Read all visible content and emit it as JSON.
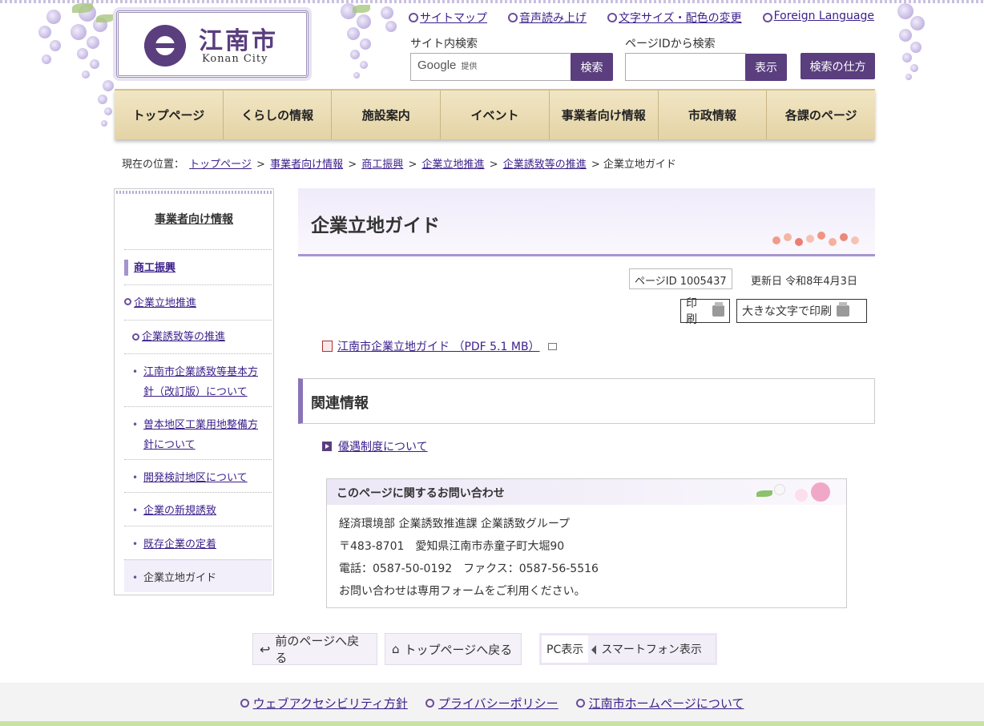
{
  "logo": {
    "jp": "江南市",
    "en": "Konan City"
  },
  "toplinks": [
    "サイトマップ",
    "音声読み上げ",
    "文字サイズ・配色の変更",
    "Foreign Language"
  ],
  "search": {
    "site_label": "サイト内検索",
    "google_text": "Google",
    "google_sub": "提供",
    "site_button": "検索",
    "pageid_label": "ページIDから検索",
    "pageid_button": "表示",
    "howto_button": "検索の仕方"
  },
  "gnav": [
    "トップページ",
    "くらしの情報",
    "施設案内",
    "イベント",
    "事業者向け情報",
    "市政情報",
    "各課のページ"
  ],
  "breadcrumb": {
    "prefix": "現在の位置：",
    "items": [
      "トップページ",
      "事業者向け情報",
      "商工振興",
      "企業立地推進",
      "企業誘致等の推進"
    ],
    "current": "企業立地ガイド",
    "sep": ">"
  },
  "sidebar": {
    "title": "事業者向け情報",
    "items": [
      "商工振興",
      "企業立地推進",
      "企業誘致等の推進",
      "江南市企業誘致等基本方針（改訂版）について",
      "曽本地区工業用地整備方針について",
      "開発検討地区について",
      "企業の新規誘致",
      "既存企業の定着",
      "企業立地ガイド"
    ]
  },
  "page": {
    "title": "企業立地ガイド",
    "pageid": "ページID 1005437",
    "updated": "更新日 令和8年4月3日",
    "print": "印刷",
    "print_large": "大きな文字で印刷",
    "pdf_link": "江南市企業立地ガイド （PDF 5.1 MB）",
    "related_heading": "関連情報",
    "related_link": "優遇制度について"
  },
  "contact": {
    "heading": "このページに関するお問い合わせ",
    "lines": [
      "経済環境部 企業誘致推進課 企業誘致グループ",
      "〒483-8701　愛知県江南市赤童子町大堀90",
      "電話：0587-50-0192　ファクス：0587-56-5516",
      "お問い合わせは専用フォームをご利用ください。"
    ]
  },
  "bottom_nav": {
    "back": "前のページへ戻る",
    "top": "トップページへ戻る",
    "pc": "PC表示",
    "smartphone": "スマートフォン表示"
  },
  "footer": [
    "ウェブアクセシビリティ方針",
    "プライバシーポリシー",
    "江南市ホームページについて"
  ],
  "colors": {
    "accent": "#5a3e7e",
    "link": "#3b1f8a",
    "nav_bg": "#e9dbb3",
    "lavender": "#a796cf"
  }
}
